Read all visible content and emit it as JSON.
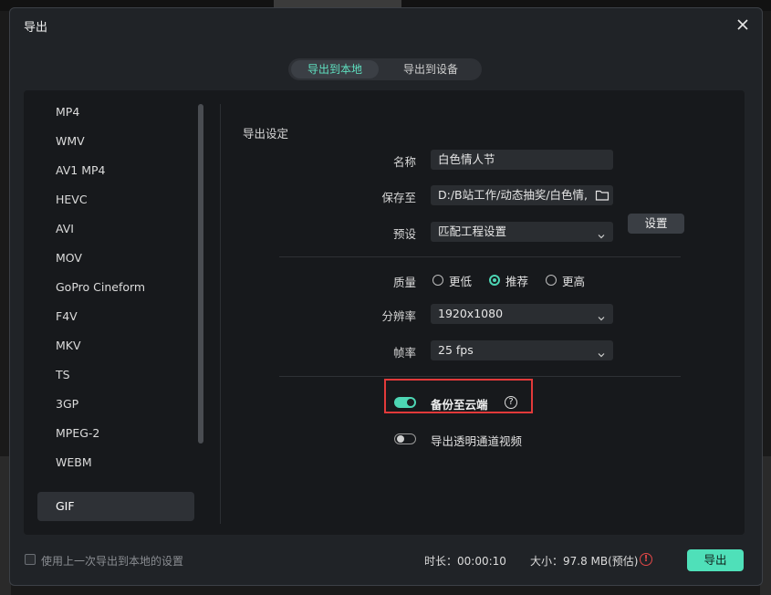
{
  "dialog": {
    "title": "导出",
    "close_icon": "close-icon"
  },
  "tabs": [
    {
      "label": "导出到本地",
      "active": true
    },
    {
      "label": "导出到设备",
      "active": false
    }
  ],
  "formats": {
    "items": [
      "MP4",
      "WMV",
      "AV1 MP4",
      "HEVC",
      "AVI",
      "MOV",
      "GoPro Cineform",
      "F4V",
      "MKV",
      "TS",
      "3GP",
      "MPEG-2",
      "WEBM",
      "GIF"
    ],
    "selected": "GIF"
  },
  "settings": {
    "section_title": "导出设定",
    "name_label": "名称",
    "name_value": "白色情人节",
    "save_label": "保存至",
    "save_value": "D:/B站工作/动态抽奖/白色情,",
    "preset_label": "预设",
    "preset_value": "匹配工程设置",
    "preset_button": "设置",
    "quality_label": "质量",
    "quality_options": [
      "更低",
      "推荐",
      "更高"
    ],
    "quality_selected": "推荐",
    "resolution_label": "分辨率",
    "resolution_value": "1920x1080",
    "framerate_label": "帧率",
    "framerate_value": "25 fps",
    "cloud_backup_label": "备份至云端",
    "cloud_backup_on": true,
    "alpha_label": "导出透明通道视频",
    "alpha_on": false
  },
  "footer": {
    "remember_label": "使用上一次导出到本地的设置",
    "duration_text": "时长：00:00:10",
    "size_text": "大小：97.8 MB(预估)",
    "export_button": "导出"
  },
  "colors": {
    "accent": "#4fe0b9",
    "highlight_border": "#e23a3a",
    "warning": "#e54848"
  }
}
